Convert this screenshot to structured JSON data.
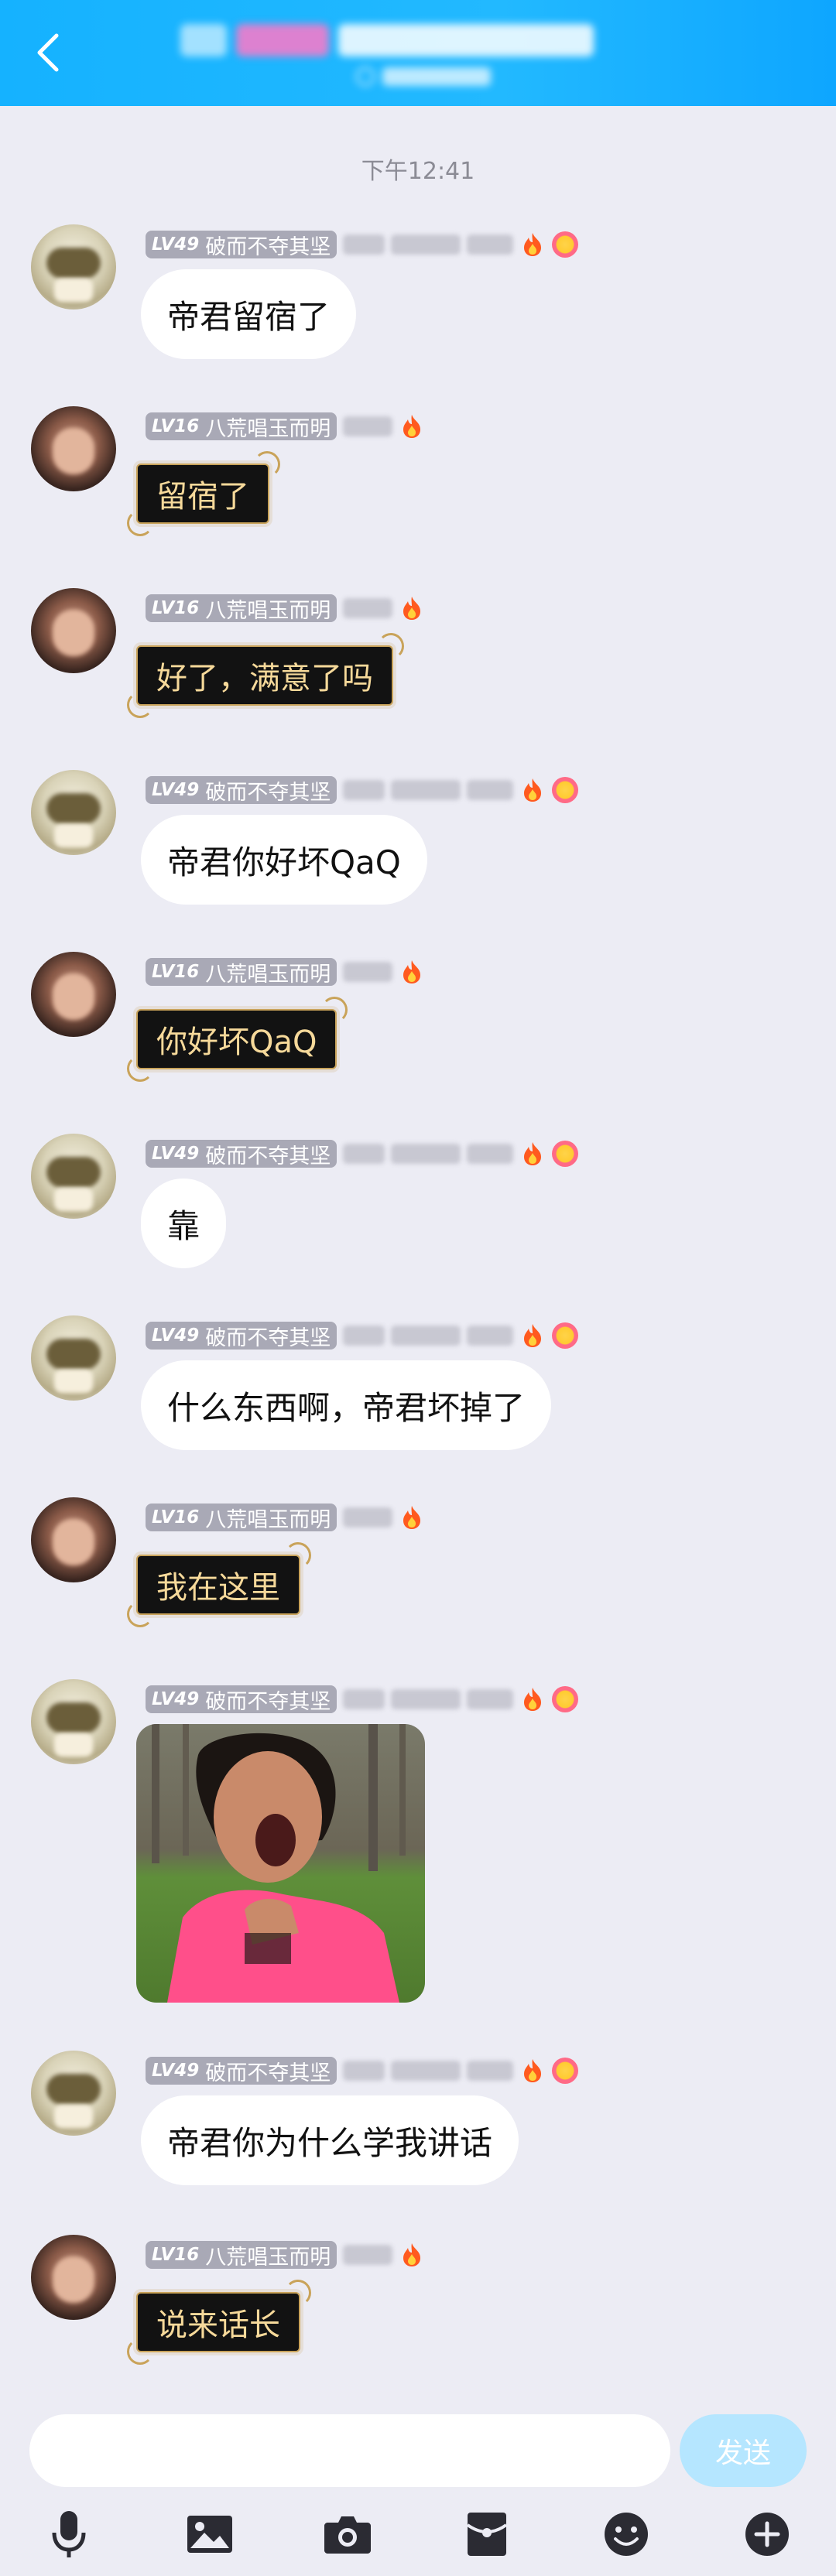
{
  "header": {
    "back_icon": "chevron-left-icon",
    "bg_color": "#18b4ff"
  },
  "chat": {
    "timestamp": "下午12:41",
    "messages": [
      {
        "sender_level": "LV49",
        "sender_name": "破而不夺其坚",
        "avatar": "a",
        "style": "normal",
        "text": "帝君留宿了",
        "badges": [
          "fire-icon",
          "smile-badge-icon"
        ]
      },
      {
        "sender_level": "LV16",
        "sender_name": "八荒唱玉而明",
        "avatar": "b",
        "style": "dark",
        "text": "留宿了",
        "badges": [
          "fire-icon"
        ]
      },
      {
        "sender_level": "LV16",
        "sender_name": "八荒唱玉而明",
        "avatar": "b",
        "style": "dark",
        "text": "好了，满意了吗",
        "badges": [
          "fire-icon"
        ]
      },
      {
        "sender_level": "LV49",
        "sender_name": "破而不夺其坚",
        "avatar": "a",
        "style": "normal",
        "text": "帝君你好坏QaQ",
        "badges": [
          "fire-icon",
          "smile-badge-icon"
        ]
      },
      {
        "sender_level": "LV16",
        "sender_name": "八荒唱玉而明",
        "avatar": "b",
        "style": "dark",
        "text": "你好坏QaQ",
        "badges": [
          "fire-icon"
        ]
      },
      {
        "sender_level": "LV49",
        "sender_name": "破而不夺其坚",
        "avatar": "a",
        "style": "normal",
        "text": "靠",
        "badges": [
          "fire-icon",
          "smile-badge-icon"
        ]
      },
      {
        "sender_level": "LV49",
        "sender_name": "破而不夺其坚",
        "avatar": "a",
        "style": "normal",
        "text": "什么东西啊，帝君坏掉了",
        "badges": [
          "fire-icon",
          "smile-badge-icon"
        ]
      },
      {
        "sender_level": "LV16",
        "sender_name": "八荒唱玉而明",
        "avatar": "b",
        "style": "dark",
        "text": "我在这里",
        "badges": [
          "fire-icon"
        ]
      },
      {
        "sender_level": "LV49",
        "sender_name": "破而不夺其坚",
        "avatar": "a",
        "style": "image",
        "text": "",
        "badges": [
          "fire-icon",
          "smile-badge-icon"
        ]
      },
      {
        "sender_level": "LV49",
        "sender_name": "破而不夺其坚",
        "avatar": "a",
        "style": "normal",
        "text": "帝君你为什么学我讲话",
        "badges": [
          "fire-icon",
          "smile-badge-icon"
        ]
      },
      {
        "sender_level": "LV16",
        "sender_name": "八荒唱玉而明",
        "avatar": "b",
        "style": "dark",
        "text": "说来话长",
        "badges": [
          "fire-icon"
        ]
      }
    ]
  },
  "input_bar": {
    "input_value": "",
    "send_label": "发送",
    "send_color": "#b5e6ff"
  },
  "toolbar": {
    "icons": [
      "microphone-icon",
      "image-icon",
      "camera-icon",
      "red-packet-icon",
      "emoji-icon",
      "plus-icon"
    ]
  }
}
